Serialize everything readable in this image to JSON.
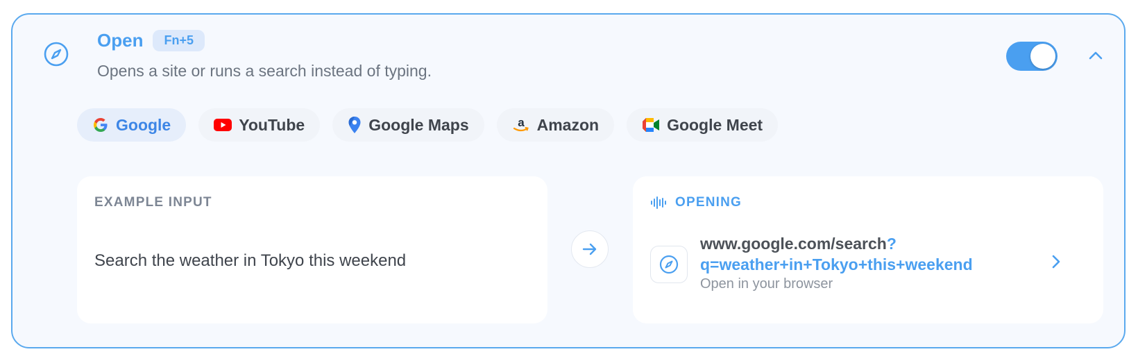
{
  "header": {
    "title": "Open",
    "shortcut": "Fn+5",
    "subtitle": "Opens a site or runs a search instead of typing.",
    "icon": "compass-icon",
    "toggle_on": true
  },
  "services": [
    {
      "label": "Google",
      "icon": "google-icon",
      "active": true
    },
    {
      "label": "YouTube",
      "icon": "youtube-icon",
      "active": false
    },
    {
      "label": "Google Maps",
      "icon": "map-pin-icon",
      "active": false
    },
    {
      "label": "Amazon",
      "icon": "amazon-icon",
      "active": false
    },
    {
      "label": "Google Meet",
      "icon": "google-meet-icon",
      "active": false
    }
  ],
  "example": {
    "label": "EXAMPLE INPUT",
    "text": "Search the weather in Tokyo this weekend"
  },
  "result": {
    "label": "OPENING",
    "url_base": "www.google.com/search",
    "url_query_line1": "?",
    "url_query_line2": "q=weather+in+Tokyo+this+weekend",
    "subtitle": "Open in your browser"
  },
  "colors": {
    "accent": "#4a9ff0",
    "border": "#5aa9ee",
    "card_bg": "#f6f9fe"
  }
}
